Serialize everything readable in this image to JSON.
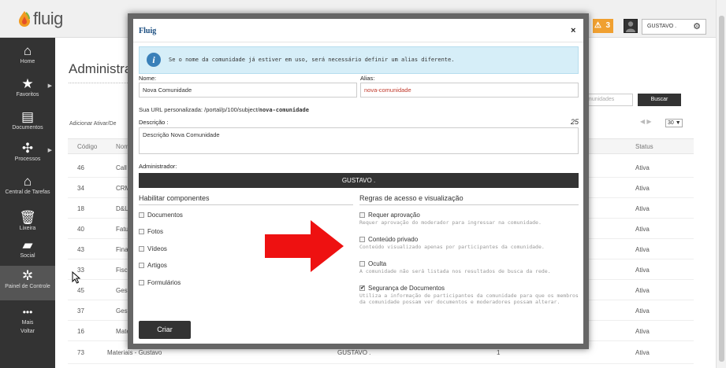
{
  "app": {
    "logo_text": "fluig",
    "alert_count": "3",
    "user_name": "GUSTAVO ."
  },
  "sidebar": {
    "items": [
      {
        "label": "Home",
        "icon": "home-icon"
      },
      {
        "label": "Favoritos",
        "icon": "star-icon"
      },
      {
        "label": "Documentos",
        "icon": "documents-icon"
      },
      {
        "label": "Processos",
        "icon": "processes-icon"
      },
      {
        "label": "Central de Tarefas",
        "icon": "task-center-icon"
      },
      {
        "label": "Lixeira",
        "icon": "trash-icon"
      },
      {
        "label": "Social",
        "icon": "social-icon"
      },
      {
        "label": "Painel de Controle",
        "icon": "control-panel-icon"
      },
      {
        "label": "Mais",
        "icon": "more-icon"
      },
      {
        "label": "Voltar",
        "icon": ""
      }
    ]
  },
  "page": {
    "title": "Administrar",
    "search_placeholder": "munidades",
    "search_button": "Buscar",
    "actions_text": "Adicionar  Ativar/De",
    "page_size": "30",
    "columns": {
      "code": "Código",
      "name": "Nom",
      "status": "Status"
    },
    "rows": [
      {
        "code": "46",
        "name": "Call",
        "status": "Ativa"
      },
      {
        "code": "34",
        "name": "CRM",
        "status": "Ativa"
      },
      {
        "code": "18",
        "name": "D&L",
        "status": "Ativa"
      },
      {
        "code": "40",
        "name": "Fatu",
        "status": "Ativa"
      },
      {
        "code": "43",
        "name": "Finar",
        "status": "Ativa"
      },
      {
        "code": "33",
        "name": "Fisca",
        "status": "Ativa"
      },
      {
        "code": "45",
        "name": "Gest",
        "status": "Ativa"
      },
      {
        "code": "37",
        "name": "Gest",
        "status": "Ativa"
      },
      {
        "code": "16",
        "name": "Mate",
        "status": "Ativa"
      },
      {
        "code": "73",
        "name": "Materiais - Gustavo",
        "owner": "GUSTAVO .",
        "count": "1",
        "status": "Ativa"
      }
    ]
  },
  "modal": {
    "title": "Fluig",
    "close": "×",
    "info": "Se o nome da comunidade já estiver em uso, será necessário definir um alias diferente.",
    "name_label": "Nome:",
    "name_value": "Nova Comunidade",
    "alias_label": "Alias:",
    "alias_value": "nova-comunidade",
    "url_prefix": "Sua URL personalizada: /portal/p/100/subject/",
    "url_slug": "nova-comunidade",
    "desc_label": "Descrição :",
    "desc_counter": "25",
    "desc_value": "Descrição Nova Comunidade",
    "admin_label": "Administrador:",
    "admin_value": "GUSTAVO .",
    "components_title": "Habilitar componentes",
    "components": [
      {
        "label": "Documentos",
        "checked": false
      },
      {
        "label": "Fotos",
        "checked": false
      },
      {
        "label": "Vídeos",
        "checked": false
      },
      {
        "label": "Artigos",
        "checked": false
      },
      {
        "label": "Formulários",
        "checked": false
      }
    ],
    "rules_title": "Regras de acesso e visualização",
    "rules": [
      {
        "label": "Requer aprovação",
        "desc": "Requer aprovação do moderador para ingressar na comunidade.",
        "checked": false
      },
      {
        "label": "Conteúdo privado",
        "desc": "Conteúdo visualizado apenas por participantes da comunidade.",
        "checked": false
      },
      {
        "label": "Oculta",
        "desc": "A comunidade não será listada nos resultados de busca da rede.",
        "checked": false
      },
      {
        "label": "Segurança de Documentos",
        "desc": "Utiliza a informação de participantes da comunidade para que os membros da comunidade possam ver documentos e moderadores possam alterar.",
        "checked": true
      }
    ],
    "submit": "Criar"
  },
  "colors": {
    "modal_title": "#1a4d80",
    "info_bg": "#d6eef8",
    "alias_text": "#c0392b",
    "alert_badge": "#f0a030",
    "arrow": "#ee1111"
  }
}
